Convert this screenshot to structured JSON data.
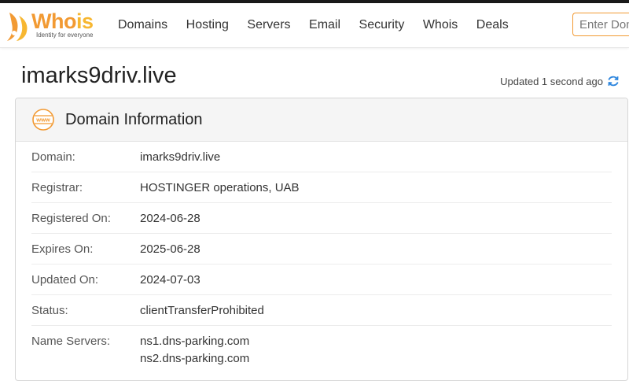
{
  "brand": {
    "name_part1": "Who",
    "name_part2": "is",
    "tagline": "Identity for everyone",
    "colors": {
      "orange": "#f29a33",
      "yellow": "#f7b731"
    }
  },
  "nav": {
    "items": [
      "Domains",
      "Hosting",
      "Servers",
      "Email",
      "Security",
      "Whois",
      "Deals"
    ]
  },
  "search": {
    "placeholder": "Enter Domain"
  },
  "page": {
    "title": "imarks9driv.live",
    "updated_text": "Updated 1 second ago",
    "refresh_icon": "refresh-icon"
  },
  "panel": {
    "icon": "www-icon",
    "title": "Domain Information",
    "rows": [
      {
        "label": "Domain:",
        "value": "imarks9driv.live"
      },
      {
        "label": "Registrar:",
        "value": "HOSTINGER operations, UAB"
      },
      {
        "label": "Registered On:",
        "value": "2024-06-28"
      },
      {
        "label": "Expires On:",
        "value": "2025-06-28"
      },
      {
        "label": "Updated On:",
        "value": "2024-07-03"
      },
      {
        "label": "Status:",
        "value": "clientTransferProhibited"
      }
    ],
    "name_servers": {
      "label": "Name Servers:",
      "values": [
        "ns1.dns-parking.com",
        "ns2.dns-parking.com"
      ]
    }
  }
}
